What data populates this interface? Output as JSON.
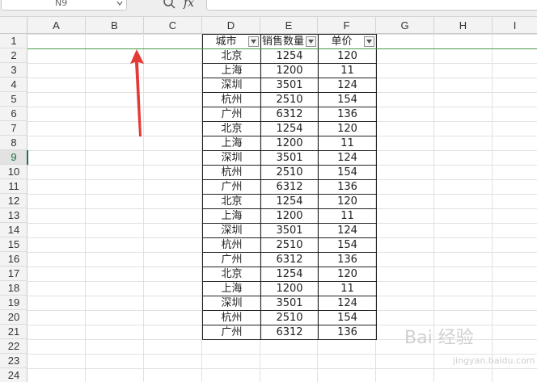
{
  "formula_bar": {
    "name_box": "N9",
    "fx_label": "fx"
  },
  "columns": [
    "A",
    "B",
    "C",
    "D",
    "E",
    "F",
    "G",
    "H",
    "I"
  ],
  "rows": [
    "1",
    "2",
    "3",
    "4",
    "5",
    "6",
    "7",
    "8",
    "9",
    "10",
    "11",
    "12",
    "13",
    "14",
    "15",
    "16",
    "17",
    "18",
    "19",
    "20",
    "21",
    "22",
    "23",
    "24"
  ],
  "table": {
    "headers": [
      "城市",
      "销售数量",
      "单价"
    ],
    "rows": [
      [
        "北京",
        "1254",
        "120"
      ],
      [
        "上海",
        "1200",
        "11"
      ],
      [
        "深圳",
        "3501",
        "124"
      ],
      [
        "杭州",
        "2510",
        "154"
      ],
      [
        "广州",
        "6312",
        "136"
      ],
      [
        "北京",
        "1254",
        "120"
      ],
      [
        "上海",
        "1200",
        "11"
      ],
      [
        "深圳",
        "3501",
        "124"
      ],
      [
        "杭州",
        "2510",
        "154"
      ],
      [
        "广州",
        "6312",
        "136"
      ],
      [
        "北京",
        "1254",
        "120"
      ],
      [
        "上海",
        "1200",
        "11"
      ],
      [
        "深圳",
        "3501",
        "124"
      ],
      [
        "杭州",
        "2510",
        "154"
      ],
      [
        "广州",
        "6312",
        "136"
      ],
      [
        "北京",
        "1254",
        "120"
      ],
      [
        "上海",
        "1200",
        "11"
      ],
      [
        "深圳",
        "3501",
        "124"
      ],
      [
        "杭州",
        "2510",
        "154"
      ],
      [
        "广州",
        "6312",
        "136"
      ]
    ]
  },
  "watermark": "Bai 经验",
  "watermark_sub": "jingyan.baidu.com",
  "colors": {
    "accent_green": "#217346",
    "arrow_red": "#e53935"
  }
}
